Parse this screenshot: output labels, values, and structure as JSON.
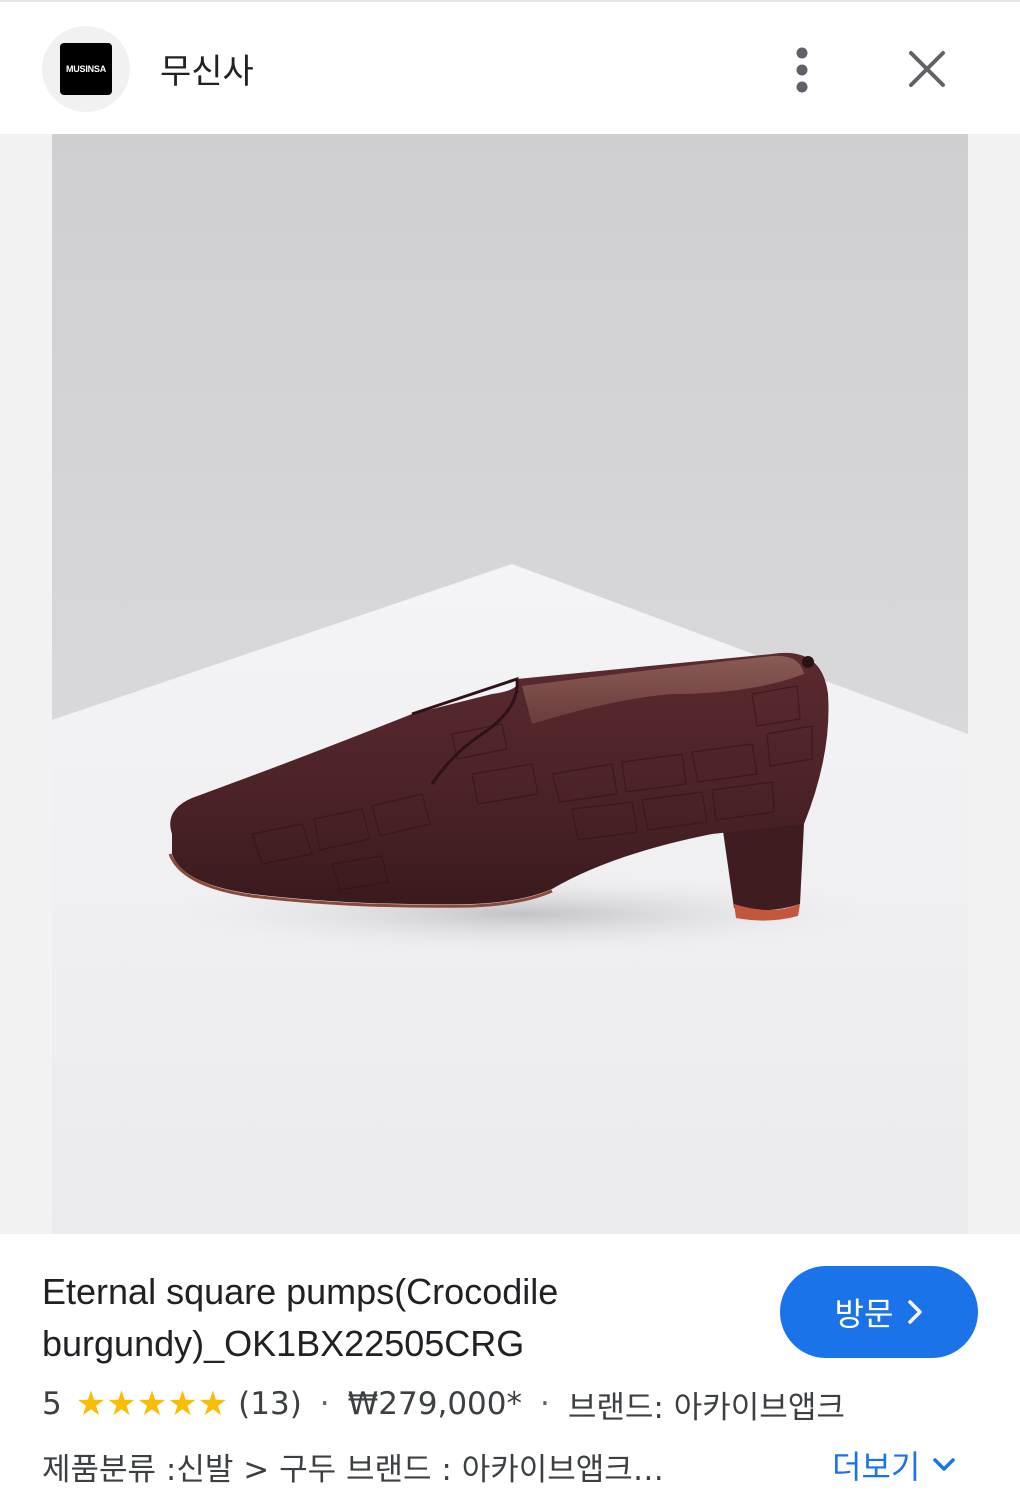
{
  "header": {
    "logo_text": "MUSINSA",
    "site_name": "무신사",
    "more_icon": "more-vert-icon",
    "close_icon": "close-icon"
  },
  "image": {
    "lens_icon": "lens-icon"
  },
  "product": {
    "title_line1": "Eternal square pumps(Crocodile",
    "title_line2": "burgundy)_OK1BX22505CRG",
    "rating": "5",
    "stars": 5,
    "review_count": "(13)",
    "separator": "·",
    "price": "₩279,000*",
    "brand_text": "브랜드: 아카이브앱크",
    "category_text": "제품분류 :신발 > 구두 브랜드 : 아카이브앱크…"
  },
  "actions": {
    "visit_label": "방문",
    "more_label": "더보기"
  },
  "colors": {
    "accent": "#1a73e8",
    "star": "#fbbc04",
    "shoe": "#4a2226"
  }
}
